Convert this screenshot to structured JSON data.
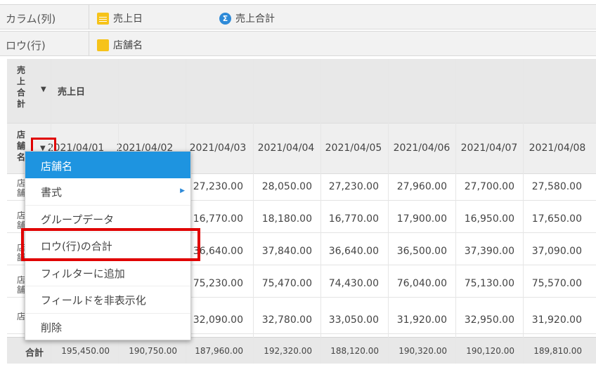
{
  "shelves": {
    "column": {
      "label": "カラム(列)",
      "pills": [
        {
          "icon": "calendar-icon",
          "text": "売上日"
        },
        {
          "icon": "sigma-icon",
          "text": "売上合計"
        }
      ]
    },
    "row": {
      "label": "ロウ(行)",
      "pills": [
        {
          "icon": "dimension-icon",
          "text": "店舗名"
        }
      ]
    }
  },
  "table": {
    "corner_label": "売上合計",
    "column_field": "売上日",
    "row_field": "店舗名",
    "dates": [
      "2021/04/01",
      "2021/04/02",
      "2021/04/03",
      "2021/04/04",
      "2021/04/05",
      "2021/04/06",
      "2021/04/07",
      "2021/04/08"
    ],
    "rows": [
      {
        "key": "店舗A",
        "values": [
          "",
          "",
          "27,230.00",
          "28,050.00",
          "27,230.00",
          "27,960.00",
          "27,700.00",
          "27,580.00"
        ]
      },
      {
        "key": "店舗B",
        "values": [
          "",
          "",
          "16,770.00",
          "18,180.00",
          "16,770.00",
          "17,900.00",
          "16,950.00",
          "17,650.00"
        ]
      },
      {
        "key": "店舗C",
        "values": [
          "",
          "",
          "36,640.00",
          "37,840.00",
          "36,640.00",
          "36,500.00",
          "37,390.00",
          "37,090.00"
        ]
      },
      {
        "key": "店舗D",
        "values": [
          "",
          "",
          "75,230.00",
          "75,470.00",
          "74,430.00",
          "76,040.00",
          "75,130.00",
          "75,570.00"
        ]
      },
      {
        "key": "店",
        "values": [
          "",
          "",
          "32,090.00",
          "32,780.00",
          "33,050.00",
          "31,920.00",
          "32,950.00",
          "31,920.00"
        ]
      }
    ],
    "total_label": "合計",
    "totals": [
      "195,450.00",
      "190,750.00",
      "187,960.00",
      "192,320.00",
      "188,120.00",
      "190,320.00",
      "190,120.00",
      "189,810.00"
    ]
  },
  "context_menu": {
    "header": "店舗名",
    "items": [
      "書式",
      "グループデータ",
      "ロウ(行)の合計",
      "フィルターに追加",
      "フィールドを非表示化",
      "削除"
    ]
  },
  "colors": {
    "accent": "#1e94e0",
    "highlight": "#e00000",
    "dimension": "#f6c31a",
    "measure": "#2e8ad8"
  }
}
